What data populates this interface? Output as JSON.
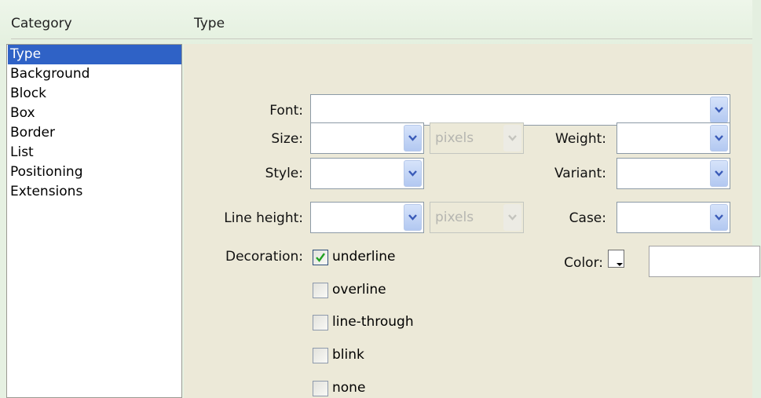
{
  "header": {
    "category_label": "Category",
    "panel_title": "Type"
  },
  "categories": [
    "Type",
    "Background",
    "Block",
    "Box",
    "Border",
    "List",
    "Positioning",
    "Extensions"
  ],
  "selected_category": "Type",
  "fields": {
    "font": {
      "label": "Font:",
      "value": ""
    },
    "size": {
      "label": "Size:",
      "value": "",
      "unit": "pixels"
    },
    "weight": {
      "label": "Weight:",
      "value": ""
    },
    "style": {
      "label": "Style:",
      "value": ""
    },
    "variant": {
      "label": "Variant:",
      "value": ""
    },
    "line_height": {
      "label": "Line height:",
      "value": "",
      "unit": "pixels"
    },
    "case": {
      "label": "Case:",
      "value": ""
    },
    "decoration": {
      "label": "Decoration:",
      "options": [
        {
          "label": "underline",
          "checked": true
        },
        {
          "label": "overline",
          "checked": false
        },
        {
          "label": "line-through",
          "checked": false
        },
        {
          "label": "blink",
          "checked": false
        },
        {
          "label": "none",
          "checked": false
        }
      ]
    },
    "color": {
      "label": "Color:",
      "value": ""
    }
  },
  "colors": {
    "selection": "#2f62c6",
    "panel": "#ece9d8",
    "frame": "#e6f1e2"
  }
}
